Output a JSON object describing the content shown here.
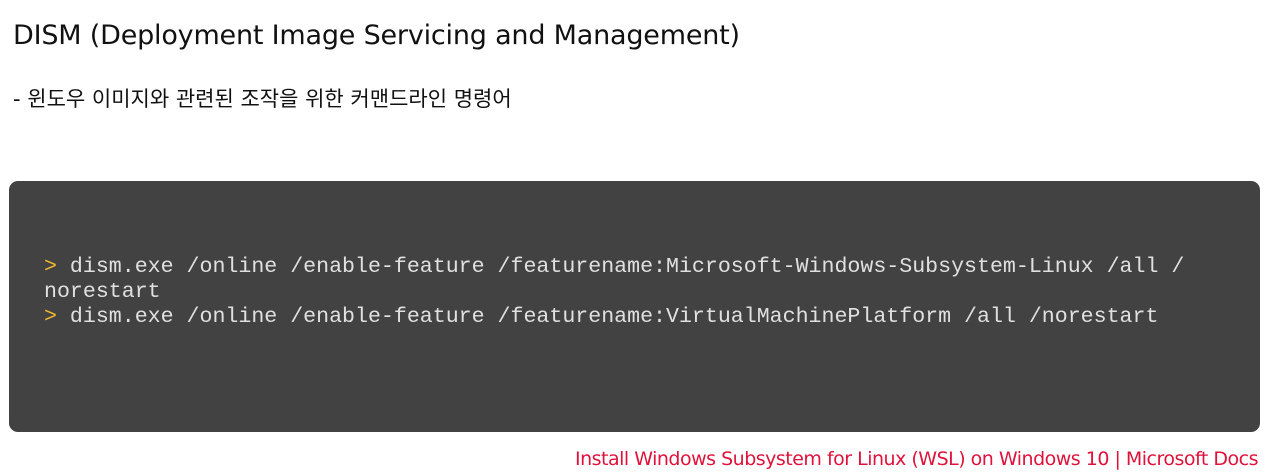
{
  "heading": {
    "title": "DISM (Deployment Image Servicing and Management)",
    "subtitle": "- 윈도우 이미지와 관련된 조작을 위한 커맨드라인 명령어"
  },
  "code": {
    "prompt_symbol": ">",
    "lines": [
      {
        "prompt": true,
        "text": " dism.exe /online /enable-feature /featurename:Microsoft-Windows-Subsystem-Linux /all /"
      },
      {
        "prompt": false,
        "text": "norestart"
      },
      {
        "prompt": true,
        "text": " dism.exe /online /enable-feature /featurename:VirtualMachinePlatform /all /norestart"
      }
    ]
  },
  "footer": {
    "link_text": "Install Windows Subsystem for Linux (WSL) on Windows 10 | Microsoft Docs"
  },
  "colors": {
    "code_background": "#424242",
    "prompt": "#f2b631",
    "link": "#e0123c"
  }
}
